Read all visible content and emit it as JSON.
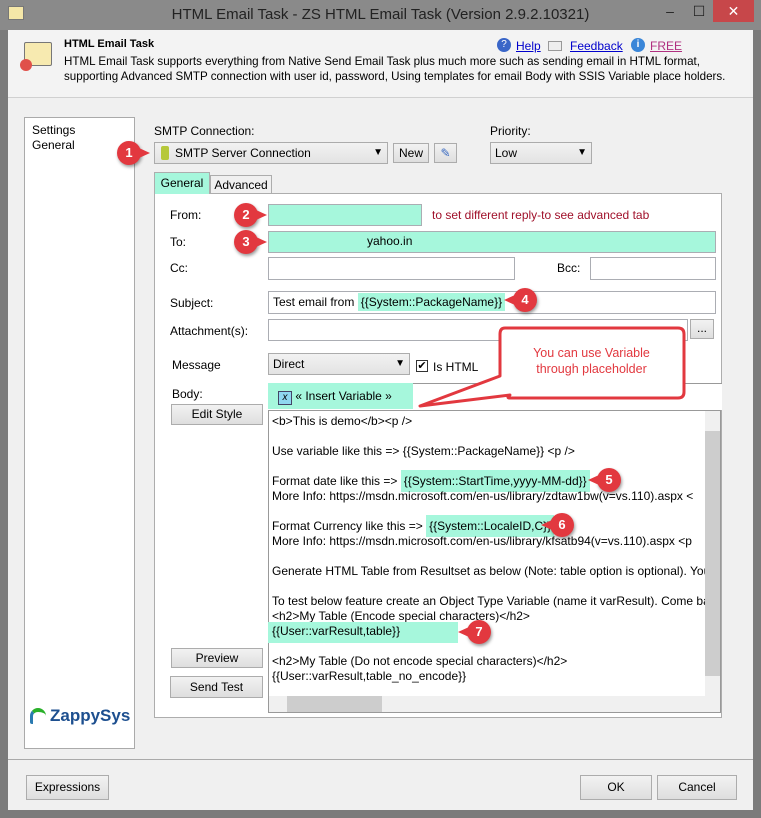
{
  "window": {
    "title": "HTML Email Task - ZS HTML Email Task (Version 2.9.2.10321)",
    "minimize": "–",
    "maximize": "☐",
    "close": "✕"
  },
  "header": {
    "title": "HTML Email Task",
    "description_line1": "HTML Email Task supports everything from Native Send Email Task plus much more such as sending email in HTML format,",
    "description_line2": "supporting Advanced SMTP connection with user id, password, Using templates for email Body with SSIS Variable place holders.",
    "help": "Help",
    "feedback": "Feedback",
    "free": "FREE"
  },
  "sidebar": {
    "items": [
      "Settings",
      "General"
    ],
    "logo": "ZappySys"
  },
  "smtp": {
    "label": "SMTP Connection:",
    "value": "SMTP Server Connection",
    "new_label": "New"
  },
  "priority": {
    "label": "Priority:",
    "value": "Low"
  },
  "tabs": [
    "General",
    "Advanced"
  ],
  "form": {
    "from_label": "From:",
    "from_value": "",
    "from_hint": "to set different reply-to see advanced tab",
    "to_label": "To:",
    "to_value": "yahoo.in",
    "cc_label": "Cc:",
    "cc_value": "",
    "bcc_label": "Bcc:",
    "bcc_value": "",
    "subject_label": "Subject:",
    "subject_prefix": "Test email from ",
    "subject_var": "{{System::PackageName}}",
    "attachment_label": "Attachment(s):",
    "browse_label": "...",
    "message_label": "Message",
    "message_value": "Direct",
    "is_html_label": "Is HTML",
    "is_html_checked": true,
    "body_label": "Body:",
    "insert_variable": "« Insert Variable »",
    "edit_style": "Edit Style",
    "preview": "Preview",
    "send_test": "Send Test"
  },
  "body_lines": [
    "<b>This is demo</b><p />",
    "Use variable like this => {{System::PackageName}} <p />",
    "Format date like this => ",
    "{{System::StartTime,yyyy-MM-dd}}",
    "More Info: https://msdn.microsoft.com/en-us/library/zdtaw1bw(v=vs.110).aspx  <",
    "Format Currency like this => ",
    "{{System::LocaleID,C}}",
    "More Info: https://msdn.microsoft.com/en-us/library/kfsatb94(v=vs.110).aspx  <p",
    "Generate HTML Table from Resultset as below (Note: table option is optional). You",
    "To test below feature create an Object Type Variable (name it varResult). Come bac",
    "<h2>My Table (Encode special characters)</h2>",
    "{{User::varResult,table}}",
    "<h2>My Table (Do not encode special characters)</h2>",
    "{{User::varResult,table_no_encode}}"
  ],
  "callout": {
    "line1": "You can use Variable",
    "line2": "through placeholder"
  },
  "badges": [
    "1",
    "2",
    "3",
    "4",
    "5",
    "6",
    "7"
  ],
  "footer": {
    "expressions": "Expressions",
    "ok": "OK",
    "cancel": "Cancel"
  },
  "colors": {
    "highlight": "#a6f7dc",
    "badge": "#e2383f",
    "callout_text": "#e2383f"
  }
}
